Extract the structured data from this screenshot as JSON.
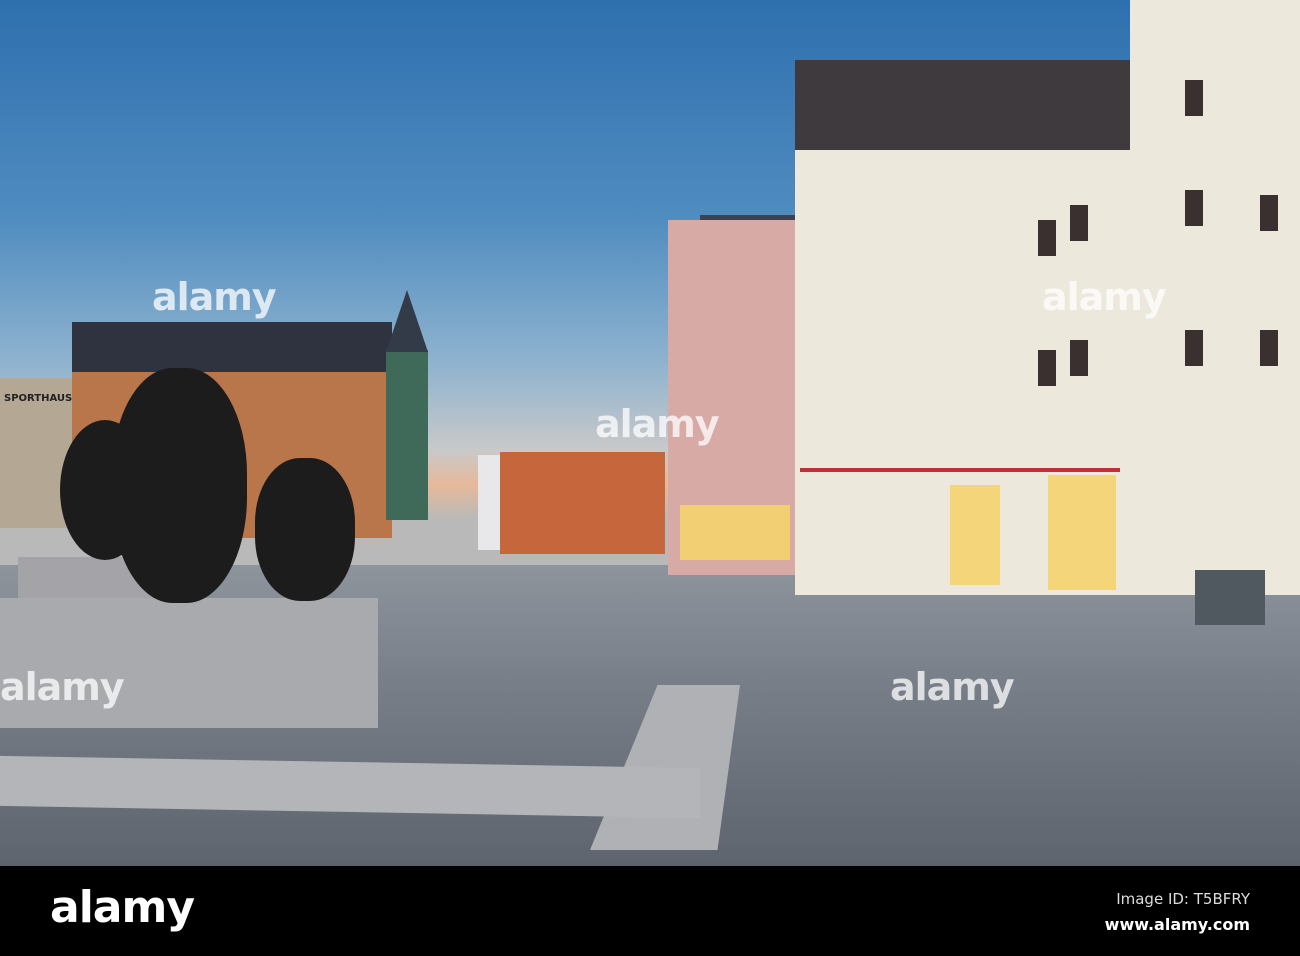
{
  "photo": {
    "description_sign": "SPORTHAUS",
    "watermark": "alamy"
  },
  "footer": {
    "logo": "alamy",
    "image_id": "Image ID: T5BFRY",
    "website": "www.alamy.com"
  }
}
